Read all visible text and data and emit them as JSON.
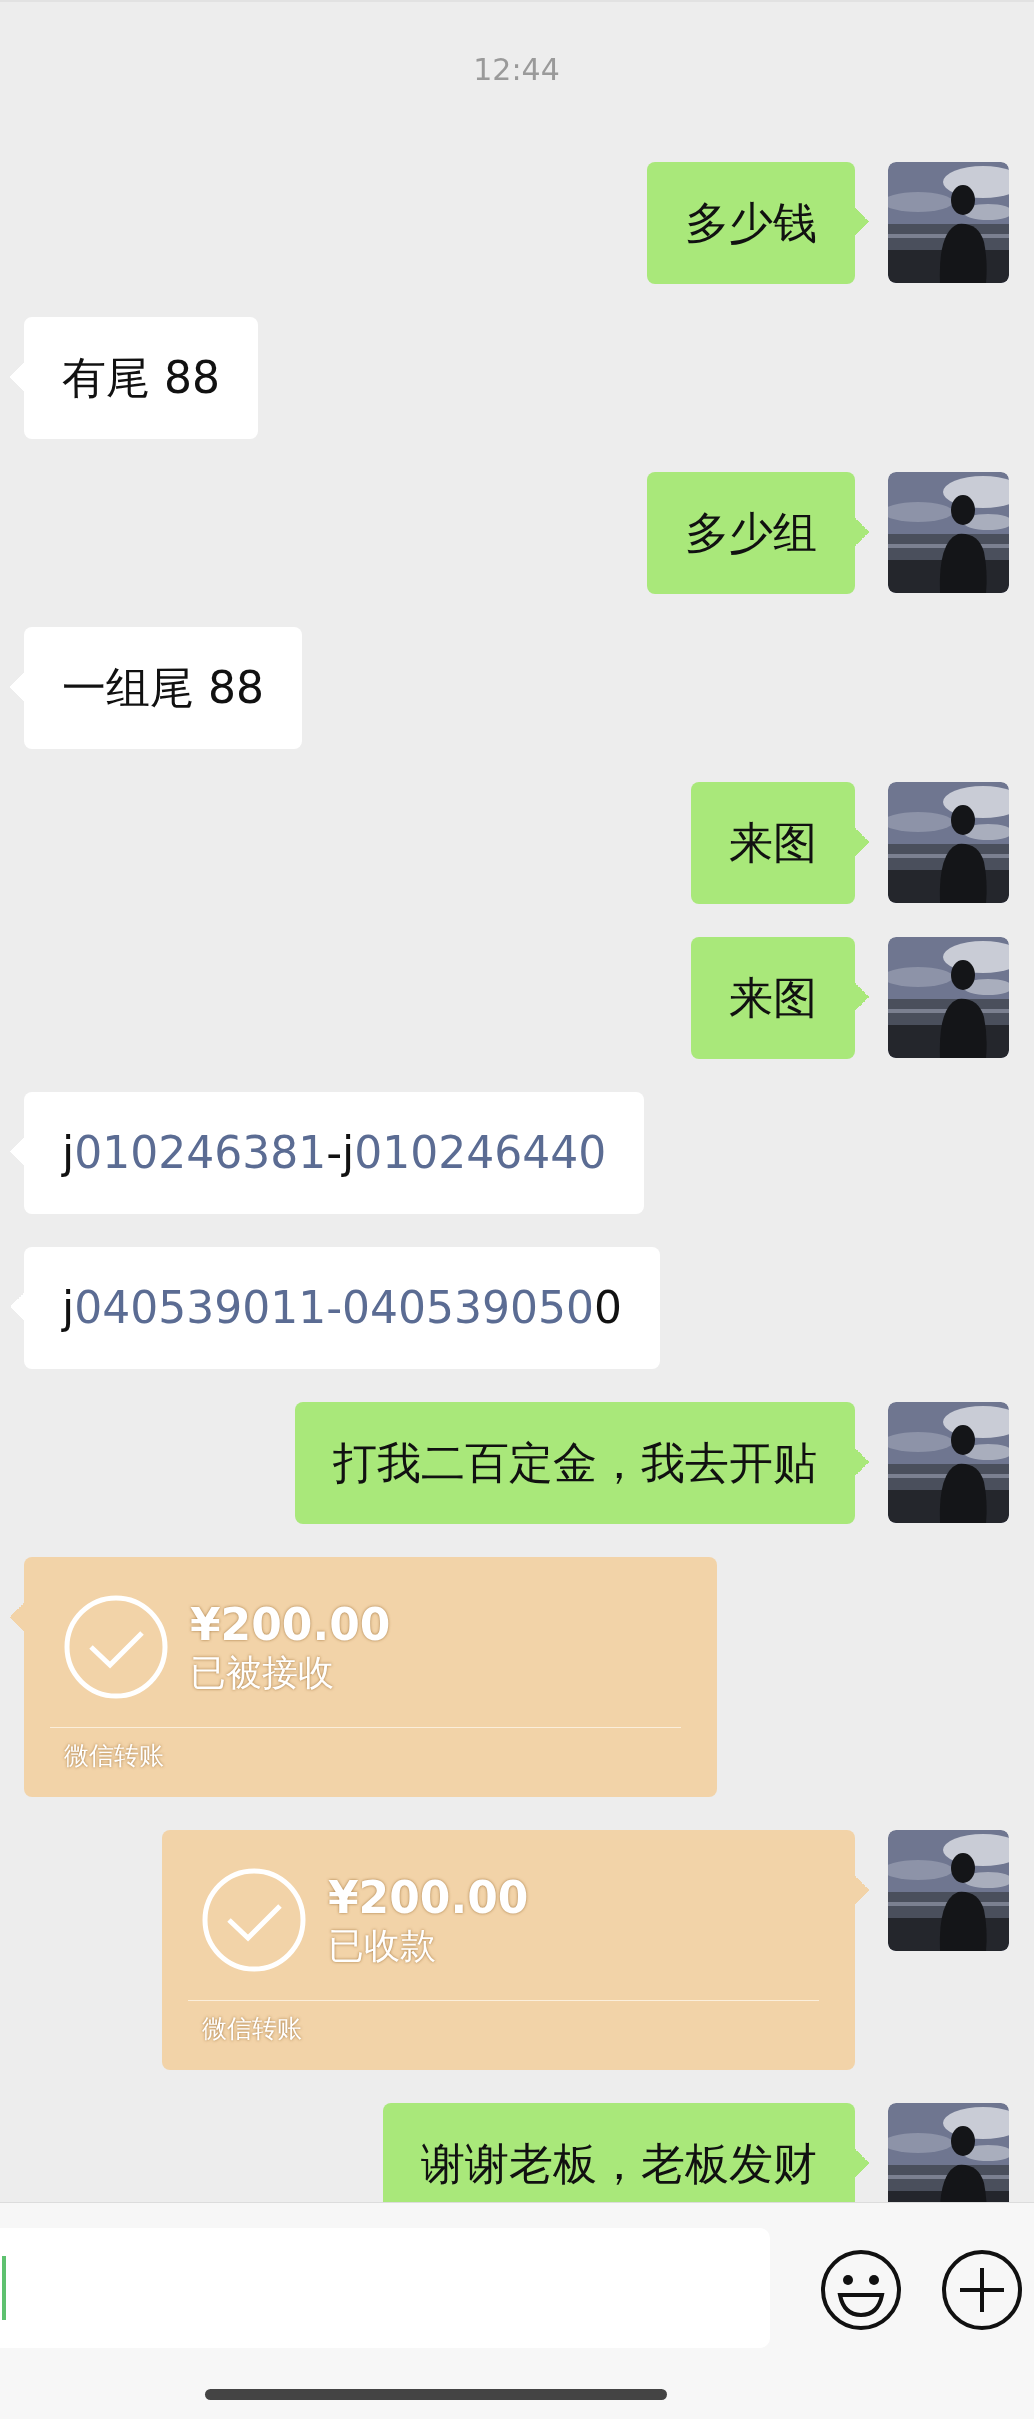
{
  "time": "12:44",
  "messages": [
    {
      "kind": "text",
      "outgoing": true,
      "text": "多少钱"
    },
    {
      "kind": "text",
      "outgoing": false,
      "text": "有尾 88"
    },
    {
      "kind": "text",
      "outgoing": true,
      "text": "多少组"
    },
    {
      "kind": "text",
      "outgoing": false,
      "text": "一组尾 88"
    },
    {
      "kind": "text",
      "outgoing": true,
      "text": "来图"
    },
    {
      "kind": "text",
      "outgoing": true,
      "text": "来图"
    },
    {
      "kind": "numbers",
      "outgoing": false,
      "segments": [
        {
          "text": "j",
          "link": false
        },
        {
          "text": "010246381",
          "link": true
        },
        {
          "text": "-j",
          "link": false
        },
        {
          "text": "010246440",
          "link": true
        }
      ]
    },
    {
      "kind": "numbers",
      "outgoing": false,
      "segments": [
        {
          "text": "j",
          "link": false
        },
        {
          "text": "040539011-040539050",
          "link": true
        },
        {
          "text": "0",
          "link": false
        }
      ]
    },
    {
      "kind": "text",
      "outgoing": true,
      "text": "打我二百定金，我去开贴"
    },
    {
      "kind": "transfer",
      "outgoing": false,
      "amount": "¥200.00",
      "status": "已被接收",
      "footer": "微信转账"
    },
    {
      "kind": "transfer",
      "outgoing": true,
      "amount": "¥200.00",
      "status": "已收款",
      "footer": "微信转账"
    },
    {
      "kind": "text",
      "outgoing": true,
      "text": "谢谢老板，老板发财"
    }
  ],
  "input": {
    "focused": true
  }
}
